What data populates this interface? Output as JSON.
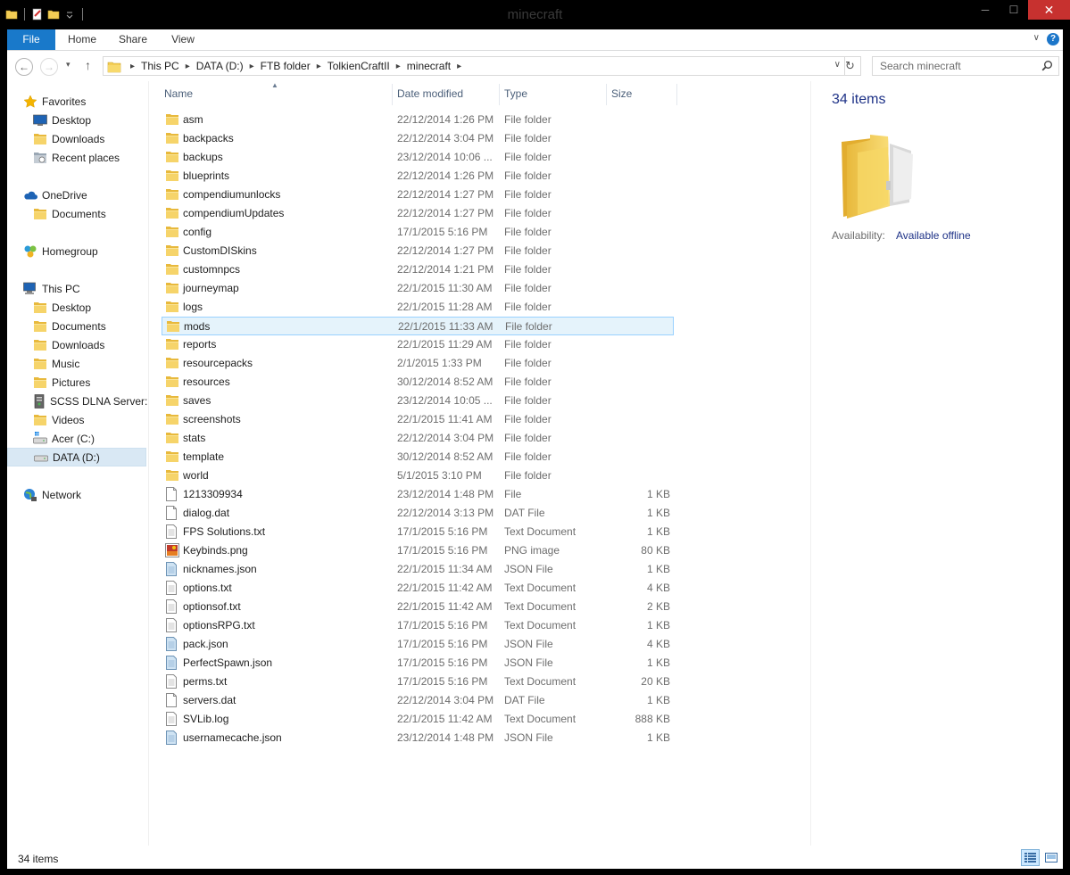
{
  "window": {
    "title": "minecraft",
    "minimize": "─",
    "maximize": "☐",
    "close": "✕"
  },
  "ribbon": {
    "tabs": [
      "File",
      "Home",
      "Share",
      "View"
    ],
    "help": "?",
    "expand": "∨"
  },
  "nav_buttons": {
    "back": "←",
    "forward": "→",
    "recent": "▾",
    "up": "↑"
  },
  "address": {
    "crumbs": [
      "This PC",
      "DATA (D:)",
      "FTB folder",
      "TolkienCraftII",
      "minecraft"
    ],
    "separator": "▸",
    "dropdown": "∨",
    "refresh": "↻"
  },
  "search": {
    "placeholder": "Search minecraft"
  },
  "nav_pane": [
    {
      "label": "Favorites",
      "icon": "star-icon",
      "level": 1
    },
    {
      "label": "Desktop",
      "icon": "desktop-icon",
      "level": 2
    },
    {
      "label": "Downloads",
      "icon": "folder-icon",
      "level": 2
    },
    {
      "label": "Recent places",
      "icon": "recent-places-icon",
      "level": 2
    },
    {
      "label": "OneDrive",
      "icon": "onedrive-icon",
      "level": 1
    },
    {
      "label": "Documents",
      "icon": "folder-icon",
      "level": 2
    },
    {
      "label": "Homegroup",
      "icon": "homegroup-icon",
      "level": 1
    },
    {
      "label": "This PC",
      "icon": "computer-icon",
      "level": 1
    },
    {
      "label": "Desktop",
      "icon": "folder-icon",
      "level": 2
    },
    {
      "label": "Documents",
      "icon": "folder-icon",
      "level": 2
    },
    {
      "label": "Downloads",
      "icon": "folder-icon",
      "level": 2
    },
    {
      "label": "Music",
      "icon": "folder-icon",
      "level": 2
    },
    {
      "label": "Pictures",
      "icon": "folder-icon",
      "level": 2
    },
    {
      "label": "SCSS DLNA Server: C",
      "icon": "media-server-icon",
      "level": 2
    },
    {
      "label": "Videos",
      "icon": "folder-icon",
      "level": 2
    },
    {
      "label": "Acer (C:)",
      "icon": "system-drive-icon",
      "level": 2
    },
    {
      "label": "DATA (D:)",
      "icon": "drive-icon",
      "level": 2,
      "selected": true
    },
    {
      "label": "Network",
      "icon": "network-icon",
      "level": 1
    }
  ],
  "columns": {
    "name": "Name",
    "date": "Date modified",
    "type": "Type",
    "size": "Size"
  },
  "files": [
    {
      "name": "asm",
      "date": "22/12/2014 1:26 PM",
      "type": "File folder",
      "size": "",
      "icon": "folder-icon"
    },
    {
      "name": "backpacks",
      "date": "22/12/2014 3:04 PM",
      "type": "File folder",
      "size": "",
      "icon": "folder-icon"
    },
    {
      "name": "backups",
      "date": "23/12/2014 10:06 ...",
      "type": "File folder",
      "size": "",
      "icon": "folder-icon"
    },
    {
      "name": "blueprints",
      "date": "22/12/2014 1:26 PM",
      "type": "File folder",
      "size": "",
      "icon": "folder-icon"
    },
    {
      "name": "compendiumunlocks",
      "date": "22/12/2014 1:27 PM",
      "type": "File folder",
      "size": "",
      "icon": "folder-icon"
    },
    {
      "name": "compendiumUpdates",
      "date": "22/12/2014 1:27 PM",
      "type": "File folder",
      "size": "",
      "icon": "folder-icon"
    },
    {
      "name": "config",
      "date": "17/1/2015 5:16 PM",
      "type": "File folder",
      "size": "",
      "icon": "folder-icon"
    },
    {
      "name": "CustomDISkins",
      "date": "22/12/2014 1:27 PM",
      "type": "File folder",
      "size": "",
      "icon": "folder-icon"
    },
    {
      "name": "customnpcs",
      "date": "22/12/2014 1:21 PM",
      "type": "File folder",
      "size": "",
      "icon": "folder-icon"
    },
    {
      "name": "journeymap",
      "date": "22/1/2015 11:30 AM",
      "type": "File folder",
      "size": "",
      "icon": "folder-icon"
    },
    {
      "name": "logs",
      "date": "22/1/2015 11:28 AM",
      "type": "File folder",
      "size": "",
      "icon": "folder-icon"
    },
    {
      "name": "mods",
      "date": "22/1/2015 11:33 AM",
      "type": "File folder",
      "size": "",
      "icon": "folder-icon",
      "selected": true
    },
    {
      "name": "reports",
      "date": "22/1/2015 11:29 AM",
      "type": "File folder",
      "size": "",
      "icon": "folder-icon"
    },
    {
      "name": "resourcepacks",
      "date": "2/1/2015 1:33 PM",
      "type": "File folder",
      "size": "",
      "icon": "folder-icon"
    },
    {
      "name": "resources",
      "date": "30/12/2014 8:52 AM",
      "type": "File folder",
      "size": "",
      "icon": "folder-icon"
    },
    {
      "name": "saves",
      "date": "23/12/2014 10:05 ...",
      "type": "File folder",
      "size": "",
      "icon": "folder-icon"
    },
    {
      "name": "screenshots",
      "date": "22/1/2015 11:41 AM",
      "type": "File folder",
      "size": "",
      "icon": "folder-icon"
    },
    {
      "name": "stats",
      "date": "22/12/2014 3:04 PM",
      "type": "File folder",
      "size": "",
      "icon": "folder-icon"
    },
    {
      "name": "template",
      "date": "30/12/2014 8:52 AM",
      "type": "File folder",
      "size": "",
      "icon": "folder-icon"
    },
    {
      "name": "world",
      "date": "5/1/2015 3:10 PM",
      "type": "File folder",
      "size": "",
      "icon": "folder-icon"
    },
    {
      "name": "1213309934",
      "date": "23/12/2014 1:48 PM",
      "type": "File",
      "size": "1 KB",
      "icon": "file-icon"
    },
    {
      "name": "dialog.dat",
      "date": "22/12/2014 3:13 PM",
      "type": "DAT File",
      "size": "1 KB",
      "icon": "file-icon"
    },
    {
      "name": "FPS Solutions.txt",
      "date": "17/1/2015 5:16 PM",
      "type": "Text Document",
      "size": "1 KB",
      "icon": "text-file-icon"
    },
    {
      "name": "Keybinds.png",
      "date": "17/1/2015 5:16 PM",
      "type": "PNG image",
      "size": "80 KB",
      "icon": "image-file-icon"
    },
    {
      "name": "nicknames.json",
      "date": "22/1/2015 11:34 AM",
      "type": "JSON File",
      "size": "1 KB",
      "icon": "json-file-icon"
    },
    {
      "name": "options.txt",
      "date": "22/1/2015 11:42 AM",
      "type": "Text Document",
      "size": "4 KB",
      "icon": "text-file-icon"
    },
    {
      "name": "optionsof.txt",
      "date": "22/1/2015 11:42 AM",
      "type": "Text Document",
      "size": "2 KB",
      "icon": "text-file-icon"
    },
    {
      "name": "optionsRPG.txt",
      "date": "17/1/2015 5:16 PM",
      "type": "Text Document",
      "size": "1 KB",
      "icon": "text-file-icon"
    },
    {
      "name": "pack.json",
      "date": "17/1/2015 5:16 PM",
      "type": "JSON File",
      "size": "4 KB",
      "icon": "json-file-icon"
    },
    {
      "name": "PerfectSpawn.json",
      "date": "17/1/2015 5:16 PM",
      "type": "JSON File",
      "size": "1 KB",
      "icon": "json-file-icon"
    },
    {
      "name": "perms.txt",
      "date": "17/1/2015 5:16 PM",
      "type": "Text Document",
      "size": "20 KB",
      "icon": "text-file-icon"
    },
    {
      "name": "servers.dat",
      "date": "22/12/2014 3:04 PM",
      "type": "DAT File",
      "size": "1 KB",
      "icon": "file-icon"
    },
    {
      "name": "SVLib.log",
      "date": "22/1/2015 11:42 AM",
      "type": "Text Document",
      "size": "888 KB",
      "icon": "text-file-icon"
    },
    {
      "name": "usernamecache.json",
      "date": "23/12/2014 1:48 PM",
      "type": "JSON File",
      "size": "1 KB",
      "icon": "json-file-icon"
    }
  ],
  "details": {
    "count": "34 items",
    "availability_label": "Availability:",
    "availability_value": "Available offline"
  },
  "status": {
    "text": "34 items"
  },
  "colors": {
    "accent": "#1979ca",
    "selection_bg": "#e5f3fb",
    "selection_border": "#99d1ff",
    "folder": "#f3cd55",
    "close": "#c7312f"
  }
}
